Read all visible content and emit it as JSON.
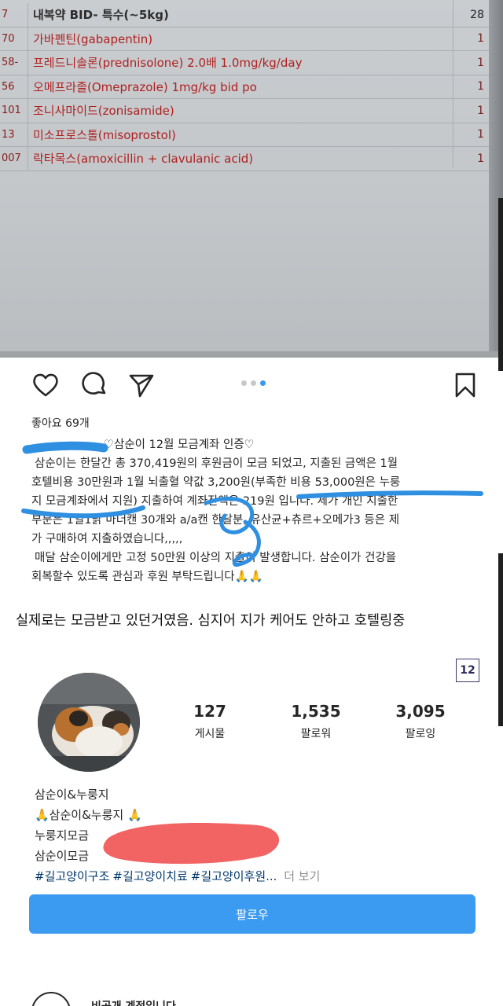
{
  "prescription": {
    "header": {
      "code": "7",
      "name": "내복약 BID- 특수(~5kg)",
      "qty": "28"
    },
    "rows": [
      {
        "code": "70",
        "name": "가바펜틴(gabapentin)",
        "qty": "1"
      },
      {
        "code": "58-",
        "name": "프레드니솔론(prednisolone) 2.0배 1.0mg/kg/day",
        "qty": "1"
      },
      {
        "code": "56",
        "name": "오메프라졸(Omeprazole) 1mg/kg bid po",
        "qty": "1"
      },
      {
        "code": "101",
        "name": "조니사마이드(zonisamide)",
        "qty": "1"
      },
      {
        "code": "13",
        "name": "미소프로스톨(misoprostol)",
        "qty": "1"
      },
      {
        "code": "007",
        "name": "락타목스(amoxicillin + clavulanic acid)",
        "qty": "1"
      }
    ]
  },
  "post": {
    "icons": [
      "heart-icon",
      "comment-icon",
      "share-icon",
      "bookmark-icon"
    ],
    "carousel": {
      "count": 3,
      "active": 3
    },
    "likes": "좋아요 69개",
    "caption": [
      "♡삼순이 12월 모금계좌 인증♡",
      "삼순이는 한달간 총 370,419원의 후원금이 모금 되었고,  지출된 금액은 1월",
      "호텔비용 30만원과 1월 뇌출혈 약값 3,200원(부족한 비용 53,000원은 누룽",
      "지 모금계좌에서 지원) 지출하여 계좌잔액은 219원 입니다. 제가 개인 지출한",
      "부분은 1일1닭 마더캔 30개와 a/a캔 한달분, 유산균+츄르+오메가3 등은 제",
      "가 구매하여 지출하였습니다,,,,,",
      "매달 삼순이에게만 고정 50만원 이상의 지출이 발생합니다. 삼순이가 건강을",
      "회복할수 있도록 관심과 후원 부탁드립니다🙏🙏"
    ]
  },
  "commentary": "실제로는 모금받고 있던거였음. 심지어 지가 케어도 안하고 호텔링중",
  "profile": {
    "badge": "12",
    "stats": [
      {
        "num": "127",
        "label": "게시물"
      },
      {
        "num": "1,535",
        "label": "팔로워"
      },
      {
        "num": "3,095",
        "label": "팔로잉"
      }
    ],
    "name": "삼순이&누룽지",
    "bio_line1": "🙏삼순이&누룽지 🙏",
    "bio_line2": "누룽지모금 ",
    "bio_line3": "삼순이모금 ",
    "tags": [
      "#길고양이구조",
      "#길고양이치료",
      "#길고양이후원..."
    ],
    "more": " 더 보기",
    "follow": "팔로우",
    "private_note": "비공개 계정입니다"
  }
}
